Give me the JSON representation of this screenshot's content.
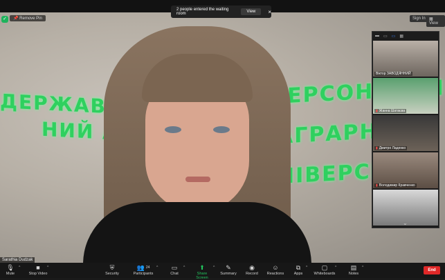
{
  "banner": {
    "text": "2 people entered the waiting room",
    "view_label": "View",
    "close": "×"
  },
  "pin": {
    "label": "Remove Pin"
  },
  "top_right": {
    "signin": "Sign In",
    "view": "View"
  },
  "main_video": {
    "speaker_name": "Sarathia Dudzak",
    "wall_text": [
      "ДЕРЖАВНИЙ",
      "НИЙ   АГРАРНИЙ",
      "ХЕРСОНСЬКИЙ",
      "АГРАРНО-",
      "НІВЕРСИТЕТ"
    ]
  },
  "gallery": {
    "participants": [
      {
        "name": "Віктор ЗАВОДЯННИЙ",
        "muted": false
      },
      {
        "name": "Жанна Шатаєва",
        "muted": true
      },
      {
        "name": "Дмитро Ладенко",
        "muted": true
      },
      {
        "name": "Володимир Кравченко",
        "muted": true
      },
      {
        "name": "",
        "muted": false
      }
    ]
  },
  "toolbar": {
    "mute": "Mute",
    "stop_video": "Stop Video",
    "security": "Security",
    "participants": "Participants",
    "participants_count": "24",
    "chat": "Chat",
    "share_screen": "Share Screen",
    "summary": "Summary",
    "record": "Record",
    "reactions": "Reactions",
    "apps": "Apps",
    "whiteboards": "Whiteboards",
    "notes": "Notes",
    "end": "End"
  },
  "colors": {
    "accent_green": "#22c55e",
    "end_red": "#e02828",
    "highlight_blue": "#3b82f6"
  }
}
